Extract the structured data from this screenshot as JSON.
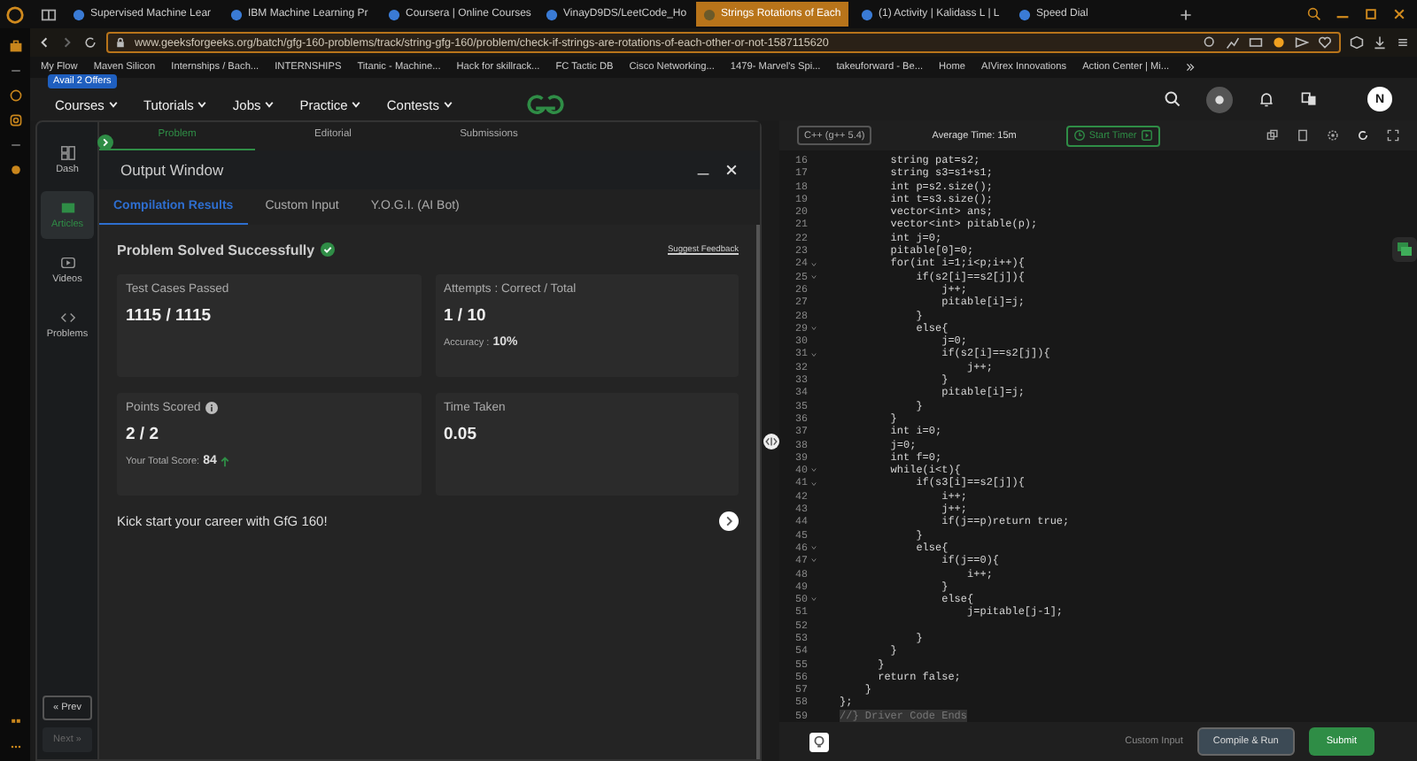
{
  "browser": {
    "tabs": [
      {
        "title": "Supervised Machine Lear",
        "selected": false
      },
      {
        "title": "IBM Machine Learning Pr",
        "selected": false
      },
      {
        "title": "Coursera | Online Courses",
        "selected": false
      },
      {
        "title": "VinayD9DS/LeetCode_Ho",
        "selected": false
      },
      {
        "title": "Strings Rotations of Each",
        "selected": true
      },
      {
        "title": "(1) Activity | Kalidass L | L",
        "selected": false
      },
      {
        "title": "Speed Dial",
        "selected": false
      }
    ],
    "url": "www.geeksforgeeks.org/batch/gfg-160-problems/track/string-gfg-160/problem/check-if-strings-are-rotations-of-each-other-or-not-1587115620",
    "bookmarks": [
      "My Flow",
      "Maven Silicon",
      "Internships / Bach...",
      "INTERNSHIPS",
      "Titanic - Machine...",
      "Hack for skillrack...",
      "FC Tactic DB",
      "Cisco Networking...",
      "1479- Marvel's Spi...",
      "takeuforward - Be...",
      "Home",
      "AIVirex Innovations",
      "Action Center | Mi..."
    ]
  },
  "site_header": {
    "offer_badge": "Avail 2 Offers",
    "nav": [
      "Courses",
      "Tutorials",
      "Jobs",
      "Practice",
      "Contests"
    ],
    "avatar": "N"
  },
  "sidebar": {
    "items": [
      {
        "label": "Dash",
        "selected": false
      },
      {
        "label": "Articles",
        "selected": true
      },
      {
        "label": "Videos",
        "selected": false
      },
      {
        "label": "Problems",
        "selected": false
      }
    ],
    "prev": {
      "label": "« Prev",
      "disabled": false
    },
    "next": {
      "label": "Next »",
      "disabled": true
    }
  },
  "problem_tabs": [
    {
      "label": "Problem",
      "selected": true
    },
    {
      "label": "Editorial",
      "selected": false
    },
    {
      "label": "Submissions",
      "selected": false
    }
  ],
  "output_window": {
    "title": "Output Window",
    "tabs": [
      {
        "label": "Compilation Results",
        "selected": true
      },
      {
        "label": "Custom Input",
        "selected": false
      },
      {
        "label": "Y.O.G.I. (AI Bot)",
        "selected": false
      }
    ],
    "status": "Problem Solved Successfully",
    "feedback_link": "Suggest Feedback",
    "cards": [
      {
        "label": "Test Cases Passed",
        "value": "1115 / 1115"
      },
      {
        "label": "Attempts : Correct / Total",
        "value": "1 / 10",
        "note_label": "Accuracy :",
        "note_value": "10%"
      },
      {
        "label": "Points Scored",
        "value": "2 / 2",
        "info": true,
        "note_label": "Your Total Score:",
        "note_value": "84",
        "trend_up": true
      },
      {
        "label": "Time Taken",
        "value": "0.05"
      }
    ],
    "promo": "Kick start your career with GfG 160!"
  },
  "editor": {
    "language": "C++ (g++ 5.4)",
    "average_time": "Average Time: 15m",
    "timer_button": "Start Timer",
    "lines": [
      {
        "number": "16",
        "code": "        string pat=s2;",
        "fold": false,
        "kind": "code"
      },
      {
        "number": "17",
        "code": "        string s3=s1+s1;",
        "fold": false,
        "kind": "code"
      },
      {
        "number": "18",
        "code": "        int p=s2.size();",
        "fold": false,
        "kind": "code"
      },
      {
        "number": "19",
        "code": "        int t=s3.size();",
        "fold": false,
        "kind": "code"
      },
      {
        "number": "20",
        "code": "        vector<int> ans;",
        "fold": false,
        "kind": "code"
      },
      {
        "number": "21",
        "code": "        vector<int> pitable(p);",
        "fold": false,
        "kind": "code"
      },
      {
        "number": "22",
        "code": "        int j=0;",
        "fold": false,
        "kind": "code"
      },
      {
        "number": "23",
        "code": "        pitable[0]=0;",
        "fold": false,
        "kind": "code"
      },
      {
        "number": "24",
        "code": "        for(int i=1;i<p;i++){",
        "fold": true,
        "kind": "code"
      },
      {
        "number": "25",
        "code": "            if(s2[i]==s2[j]){",
        "fold": true,
        "kind": "code"
      },
      {
        "number": "26",
        "code": "                j++;",
        "fold": false,
        "kind": "code"
      },
      {
        "number": "27",
        "code": "                pitable[i]=j;",
        "fold": false,
        "kind": "code"
      },
      {
        "number": "28",
        "code": "            }",
        "fold": false,
        "kind": "code"
      },
      {
        "number": "29",
        "code": "            else{",
        "fold": true,
        "kind": "code"
      },
      {
        "number": "30",
        "code": "                j=0;",
        "fold": false,
        "kind": "code"
      },
      {
        "number": "31",
        "code": "                if(s2[i]==s2[j]){",
        "fold": true,
        "kind": "code"
      },
      {
        "number": "32",
        "code": "                    j++;",
        "fold": false,
        "kind": "code"
      },
      {
        "number": "33",
        "code": "                }",
        "fold": false,
        "kind": "code"
      },
      {
        "number": "34",
        "code": "                pitable[i]=j;",
        "fold": false,
        "kind": "code"
      },
      {
        "number": "35",
        "code": "            }",
        "fold": false,
        "kind": "code"
      },
      {
        "number": "36",
        "code": "        }",
        "fold": false,
        "kind": "code"
      },
      {
        "number": "37",
        "code": "        int i=0;",
        "fold": false,
        "kind": "code"
      },
      {
        "number": "38",
        "code": "        j=0;",
        "fold": false,
        "kind": "code"
      },
      {
        "number": "39",
        "code": "        int f=0;",
        "fold": false,
        "kind": "code"
      },
      {
        "number": "40",
        "code": "        while(i<t){",
        "fold": true,
        "kind": "code"
      },
      {
        "number": "41",
        "code": "            if(s3[i]==s2[j]){",
        "fold": true,
        "kind": "code"
      },
      {
        "number": "42",
        "code": "                i++;",
        "fold": false,
        "kind": "code"
      },
      {
        "number": "43",
        "code": "                j++;",
        "fold": false,
        "kind": "code"
      },
      {
        "number": "44",
        "code": "                if(j==p)return true;",
        "fold": false,
        "kind": "code"
      },
      {
        "number": "45",
        "code": "            }",
        "fold": false,
        "kind": "code"
      },
      {
        "number": "46",
        "code": "            else{",
        "fold": true,
        "kind": "code"
      },
      {
        "number": "47",
        "code": "                if(j==0){",
        "fold": true,
        "kind": "code"
      },
      {
        "number": "48",
        "code": "                    i++;",
        "fold": false,
        "kind": "code"
      },
      {
        "number": "49",
        "code": "                }",
        "fold": false,
        "kind": "code"
      },
      {
        "number": "50",
        "code": "                else{",
        "fold": true,
        "kind": "code"
      },
      {
        "number": "51",
        "code": "                    j=pitable[j-1];",
        "fold": false,
        "kind": "code"
      },
      {
        "number": "52",
        "fold": false,
        "kind": "code"
      },
      {
        "number": "53",
        "code": "            }",
        "fold": false,
        "kind": "code"
      },
      {
        "number": "54",
        "code": "        }",
        "fold": false,
        "kind": "code"
      },
      {
        "number": "55",
        "code": "      }",
        "fold": false,
        "kind": "code"
      },
      {
        "number": "56",
        "code": "      return false;",
        "fold": false,
        "kind": "code"
      },
      {
        "number": "57",
        "code": "    }",
        "fold": false,
        "kind": "code"
      },
      {
        "number": "58",
        "code": "};",
        "fold": false,
        "kind": "code"
      },
      {
        "number": "59",
        "code": "//} Driver Code Ends",
        "fold": false,
        "kind": "comment"
      }
    ],
    "custom_input": "Custom Input",
    "compile_button": "Compile & Run",
    "submit_button": "Submit"
  }
}
